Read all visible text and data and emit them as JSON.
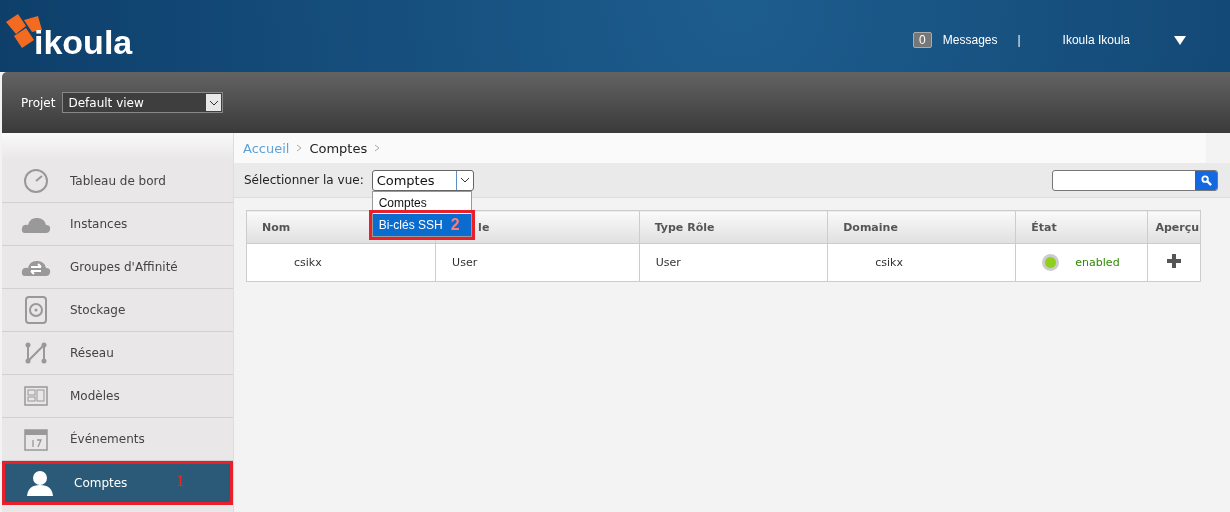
{
  "logo": {
    "text": "ikoula"
  },
  "header": {
    "message_count": "0",
    "messages_label": "Messages",
    "separator": "|",
    "user": "Ikoula Ikoula"
  },
  "project": {
    "label": "Projet",
    "value": "Default view"
  },
  "sidebar": {
    "items": [
      {
        "label": "Tableau de bord",
        "selected": false
      },
      {
        "label": "Instances",
        "selected": false
      },
      {
        "label": "Groupes d'Affinité",
        "selected": false
      },
      {
        "label": "Stockage",
        "selected": false
      },
      {
        "label": "Réseau",
        "selected": false
      },
      {
        "label": "Modèles",
        "selected": false
      },
      {
        "label": "Événements",
        "selected": false
      },
      {
        "label": "Comptes",
        "selected": true,
        "annotation": "1"
      }
    ]
  },
  "breadcrumb": [
    {
      "label": "Accueil",
      "link": true
    },
    {
      "label": "Comptes",
      "link": false
    }
  ],
  "view_select": {
    "label": "Sélectionner la vue:",
    "value": "Comptes",
    "expanded": true,
    "options": [
      {
        "label": "Comptes",
        "highlighted": false
      },
      {
        "label": "Bi-clés SSH",
        "highlighted": true,
        "annotation": "2"
      }
    ]
  },
  "table": {
    "columns": [
      "Nom",
      "le",
      "Type Rôle",
      "Domaine",
      "État",
      "Aperçu"
    ],
    "rows": [
      {
        "name": "csikx",
        "role": "User",
        "role_type": "User",
        "domain": "csikx",
        "state": "enabled",
        "state_on": true
      }
    ]
  }
}
